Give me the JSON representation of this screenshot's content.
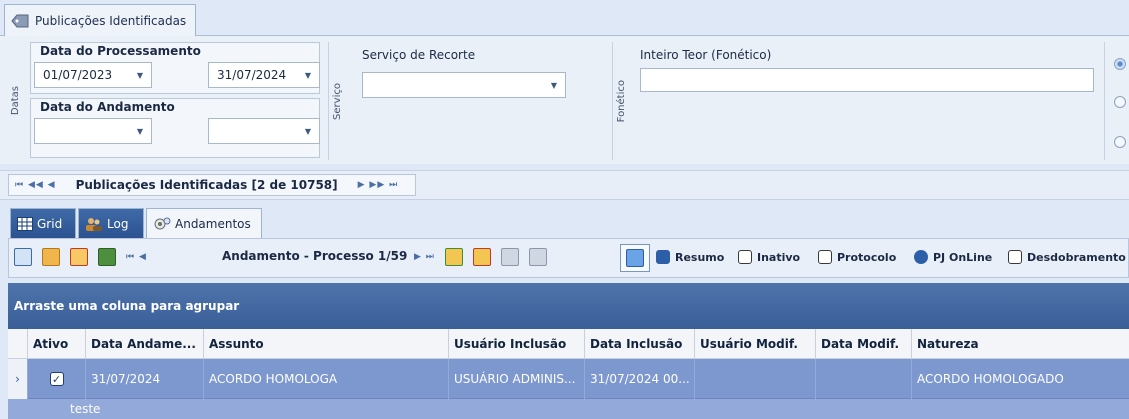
{
  "top_tab": {
    "label": "Publicações Identificadas"
  },
  "filters": {
    "datas_label": "Datas",
    "servico_label": "Serviço",
    "fonetico_label": "Fonético",
    "data_processamento": {
      "title": "Data do Processamento",
      "from": "01/07/2023",
      "to": "31/07/2024"
    },
    "data_andamento": {
      "title": "Data do Andamento",
      "from": "",
      "to": ""
    },
    "servico_recorte": {
      "title": "Serviço de Recorte",
      "value": ""
    },
    "inteiro_teor": {
      "title": "Inteiro Teor (Fonético)",
      "value": ""
    }
  },
  "nav": {
    "label": "Publicações Identificadas [2 de 10758]"
  },
  "tabs": [
    {
      "label": "Grid",
      "icon": "grid-icon"
    },
    {
      "label": "Log",
      "icon": "users-icon"
    },
    {
      "label": "Andamentos",
      "icon": "gears-icon"
    }
  ],
  "toolbar": {
    "process_label": "Andamento - Processo 1/59",
    "options": [
      {
        "label": "Resumo",
        "checked": true
      },
      {
        "label": "Inativo",
        "checked": false
      },
      {
        "label": "Protocolo",
        "checked": false
      },
      {
        "label": "PJ OnLine",
        "checked": true
      },
      {
        "label": "Desdobramento",
        "checked": false
      }
    ]
  },
  "grid": {
    "group_hint": "Arraste uma coluna para agrupar",
    "columns": [
      "Ativo",
      "Data Andame...",
      "Assunto",
      "Usuário Inclusão",
      "Data Inclusão",
      "Usuário Modif.",
      "Data Modif.",
      "Natureza"
    ],
    "rows": [
      {
        "ativo": true,
        "data_andamento": "31/07/2024",
        "assunto": "ACORDO HOMOLOGA",
        "usuario_inclusao": "USUÁRIO ADMINIS...",
        "data_inclusao": "31/07/2024 00...",
        "usuario_modif": "",
        "data_modif": "",
        "natureza": "ACORDO HOMOLOGADO",
        "preview": "teste"
      }
    ]
  },
  "colors": {
    "accent": "#3a5f98",
    "selected_row": "#7d97cf"
  }
}
